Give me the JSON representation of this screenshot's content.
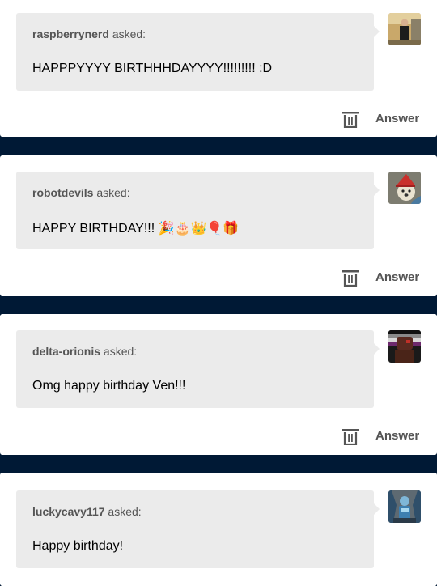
{
  "asks": [
    {
      "asker": "raspberrynerd",
      "asked_label": "asked:",
      "question": "HAPPPYYYY BIRTHHHDAYYYY!!!!!!!!! :D",
      "emoji": "",
      "avatar_icon": "man-in-suit-avatar",
      "answer_label": "Answer"
    },
    {
      "asker": "robotdevils",
      "asked_label": "asked:",
      "question": "HAPPY BIRTHDAY!!!",
      "emoji": "🎉🎂👑🎈🎁",
      "avatar_icon": "dog-in-hat-avatar",
      "answer_label": "Answer"
    },
    {
      "asker": "delta-orionis",
      "asked_label": "asked:",
      "question": "Omg happy birthday Ven!!!",
      "emoji": "",
      "avatar_icon": "dark-figure-avatar",
      "answer_label": "Answer"
    },
    {
      "asker": "luckycavy117",
      "asked_label": "asked:",
      "question": "Happy birthday!",
      "emoji": "",
      "avatar_icon": "blue-armor-avatar",
      "answer_label": ""
    }
  ],
  "colors": {
    "background": "#001935",
    "card": "#ffffff",
    "bubble": "#ebebeb",
    "muted_text": "#555555"
  }
}
